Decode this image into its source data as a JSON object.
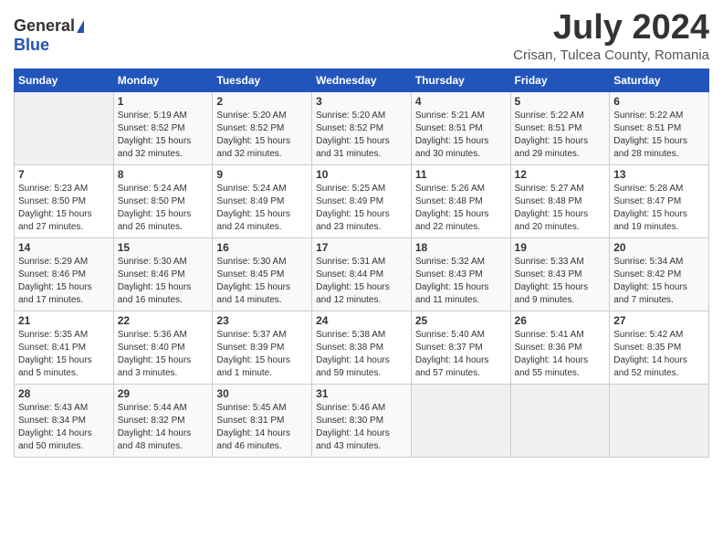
{
  "logo": {
    "general": "General",
    "blue": "Blue"
  },
  "title": {
    "month_year": "July 2024",
    "location": "Crisan, Tulcea County, Romania"
  },
  "days_of_week": [
    "Sunday",
    "Monday",
    "Tuesday",
    "Wednesday",
    "Thursday",
    "Friday",
    "Saturday"
  ],
  "weeks": [
    [
      {
        "day": "",
        "sunrise": "",
        "sunset": "",
        "daylight": ""
      },
      {
        "day": "1",
        "sunrise": "Sunrise: 5:19 AM",
        "sunset": "Sunset: 8:52 PM",
        "daylight": "Daylight: 15 hours and 32 minutes."
      },
      {
        "day": "2",
        "sunrise": "Sunrise: 5:20 AM",
        "sunset": "Sunset: 8:52 PM",
        "daylight": "Daylight: 15 hours and 32 minutes."
      },
      {
        "day": "3",
        "sunrise": "Sunrise: 5:20 AM",
        "sunset": "Sunset: 8:52 PM",
        "daylight": "Daylight: 15 hours and 31 minutes."
      },
      {
        "day": "4",
        "sunrise": "Sunrise: 5:21 AM",
        "sunset": "Sunset: 8:51 PM",
        "daylight": "Daylight: 15 hours and 30 minutes."
      },
      {
        "day": "5",
        "sunrise": "Sunrise: 5:22 AM",
        "sunset": "Sunset: 8:51 PM",
        "daylight": "Daylight: 15 hours and 29 minutes."
      },
      {
        "day": "6",
        "sunrise": "Sunrise: 5:22 AM",
        "sunset": "Sunset: 8:51 PM",
        "daylight": "Daylight: 15 hours and 28 minutes."
      }
    ],
    [
      {
        "day": "7",
        "sunrise": "Sunrise: 5:23 AM",
        "sunset": "Sunset: 8:50 PM",
        "daylight": "Daylight: 15 hours and 27 minutes."
      },
      {
        "day": "8",
        "sunrise": "Sunrise: 5:24 AM",
        "sunset": "Sunset: 8:50 PM",
        "daylight": "Daylight: 15 hours and 26 minutes."
      },
      {
        "day": "9",
        "sunrise": "Sunrise: 5:24 AM",
        "sunset": "Sunset: 8:49 PM",
        "daylight": "Daylight: 15 hours and 24 minutes."
      },
      {
        "day": "10",
        "sunrise": "Sunrise: 5:25 AM",
        "sunset": "Sunset: 8:49 PM",
        "daylight": "Daylight: 15 hours and 23 minutes."
      },
      {
        "day": "11",
        "sunrise": "Sunrise: 5:26 AM",
        "sunset": "Sunset: 8:48 PM",
        "daylight": "Daylight: 15 hours and 22 minutes."
      },
      {
        "day": "12",
        "sunrise": "Sunrise: 5:27 AM",
        "sunset": "Sunset: 8:48 PM",
        "daylight": "Daylight: 15 hours and 20 minutes."
      },
      {
        "day": "13",
        "sunrise": "Sunrise: 5:28 AM",
        "sunset": "Sunset: 8:47 PM",
        "daylight": "Daylight: 15 hours and 19 minutes."
      }
    ],
    [
      {
        "day": "14",
        "sunrise": "Sunrise: 5:29 AM",
        "sunset": "Sunset: 8:46 PM",
        "daylight": "Daylight: 15 hours and 17 minutes."
      },
      {
        "day": "15",
        "sunrise": "Sunrise: 5:30 AM",
        "sunset": "Sunset: 8:46 PM",
        "daylight": "Daylight: 15 hours and 16 minutes."
      },
      {
        "day": "16",
        "sunrise": "Sunrise: 5:30 AM",
        "sunset": "Sunset: 8:45 PM",
        "daylight": "Daylight: 15 hours and 14 minutes."
      },
      {
        "day": "17",
        "sunrise": "Sunrise: 5:31 AM",
        "sunset": "Sunset: 8:44 PM",
        "daylight": "Daylight: 15 hours and 12 minutes."
      },
      {
        "day": "18",
        "sunrise": "Sunrise: 5:32 AM",
        "sunset": "Sunset: 8:43 PM",
        "daylight": "Daylight: 15 hours and 11 minutes."
      },
      {
        "day": "19",
        "sunrise": "Sunrise: 5:33 AM",
        "sunset": "Sunset: 8:43 PM",
        "daylight": "Daylight: 15 hours and 9 minutes."
      },
      {
        "day": "20",
        "sunrise": "Sunrise: 5:34 AM",
        "sunset": "Sunset: 8:42 PM",
        "daylight": "Daylight: 15 hours and 7 minutes."
      }
    ],
    [
      {
        "day": "21",
        "sunrise": "Sunrise: 5:35 AM",
        "sunset": "Sunset: 8:41 PM",
        "daylight": "Daylight: 15 hours and 5 minutes."
      },
      {
        "day": "22",
        "sunrise": "Sunrise: 5:36 AM",
        "sunset": "Sunset: 8:40 PM",
        "daylight": "Daylight: 15 hours and 3 minutes."
      },
      {
        "day": "23",
        "sunrise": "Sunrise: 5:37 AM",
        "sunset": "Sunset: 8:39 PM",
        "daylight": "Daylight: 15 hours and 1 minute."
      },
      {
        "day": "24",
        "sunrise": "Sunrise: 5:38 AM",
        "sunset": "Sunset: 8:38 PM",
        "daylight": "Daylight: 14 hours and 59 minutes."
      },
      {
        "day": "25",
        "sunrise": "Sunrise: 5:40 AM",
        "sunset": "Sunset: 8:37 PM",
        "daylight": "Daylight: 14 hours and 57 minutes."
      },
      {
        "day": "26",
        "sunrise": "Sunrise: 5:41 AM",
        "sunset": "Sunset: 8:36 PM",
        "daylight": "Daylight: 14 hours and 55 minutes."
      },
      {
        "day": "27",
        "sunrise": "Sunrise: 5:42 AM",
        "sunset": "Sunset: 8:35 PM",
        "daylight": "Daylight: 14 hours and 52 minutes."
      }
    ],
    [
      {
        "day": "28",
        "sunrise": "Sunrise: 5:43 AM",
        "sunset": "Sunset: 8:34 PM",
        "daylight": "Daylight: 14 hours and 50 minutes."
      },
      {
        "day": "29",
        "sunrise": "Sunrise: 5:44 AM",
        "sunset": "Sunset: 8:32 PM",
        "daylight": "Daylight: 14 hours and 48 minutes."
      },
      {
        "day": "30",
        "sunrise": "Sunrise: 5:45 AM",
        "sunset": "Sunset: 8:31 PM",
        "daylight": "Daylight: 14 hours and 46 minutes."
      },
      {
        "day": "31",
        "sunrise": "Sunrise: 5:46 AM",
        "sunset": "Sunset: 8:30 PM",
        "daylight": "Daylight: 14 hours and 43 minutes."
      },
      {
        "day": "",
        "sunrise": "",
        "sunset": "",
        "daylight": ""
      },
      {
        "day": "",
        "sunrise": "",
        "sunset": "",
        "daylight": ""
      },
      {
        "day": "",
        "sunrise": "",
        "sunset": "",
        "daylight": ""
      }
    ]
  ]
}
